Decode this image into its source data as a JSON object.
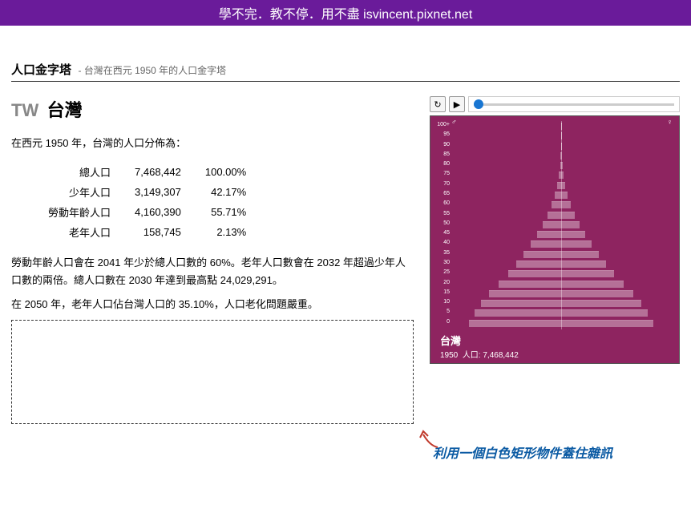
{
  "banner": "學不完．教不停．用不盡 isvincent.pixnet.net",
  "title": "人口金字塔",
  "subtitle": "- 台灣在西元 1950 年的人口金字塔",
  "country_code": "TW",
  "country_name": "台灣",
  "intro": "在西元 1950 年，台灣的人口分佈為：",
  "stats": [
    {
      "label": "總人口",
      "value": "7,468,442",
      "pct": "100.00%"
    },
    {
      "label": "少年人口",
      "value": "3,149,307",
      "pct": "42.17%"
    },
    {
      "label": "勞動年齡人口",
      "value": "4,160,390",
      "pct": "55.71%"
    },
    {
      "label": "老年人口",
      "value": "158,745",
      "pct": "2.13%"
    }
  ],
  "desc1": "勞動年齡人口會在 2041 年少於總人口數的 60%。老年人口數會在 2032 年超過少年人口數的兩倍。總人口數在 2030 年達到最高點 24,029,291。",
  "desc2": "在 2050 年，老年人口佔台灣人口的 35.10%，人口老化問題嚴重。",
  "annotation": "利用一個白色矩形物件蓋住雜訊",
  "pyramid": {
    "country": "台灣",
    "year": "1950",
    "pop_label": "人口: 7,468,442",
    "male_icon": "♂",
    "female_icon": "♀"
  },
  "chart_data": {
    "type": "population-pyramid",
    "title": "台灣 1950 人口金字塔",
    "age_groups": [
      "100+",
      "95",
      "90",
      "85",
      "80",
      "75",
      "70",
      "65",
      "60",
      "55",
      "50",
      "45",
      "40",
      "35",
      "30",
      "25",
      "20",
      "15",
      "10",
      "5",
      "0"
    ],
    "male_pct": [
      0.1,
      0.2,
      0.4,
      0.8,
      1.5,
      3,
      5,
      8,
      12,
      17,
      23,
      30,
      38,
      47,
      56,
      66,
      78,
      90,
      100,
      108,
      115
    ],
    "female_pct": [
      0.1,
      0.2,
      0.4,
      0.8,
      1.5,
      3,
      5,
      8,
      12,
      17,
      23,
      30,
      38,
      47,
      56,
      66,
      78,
      90,
      100,
      108,
      115
    ],
    "unit": "relative-width-px",
    "note": "Widths are visual approximations scaled to half-chart width"
  }
}
